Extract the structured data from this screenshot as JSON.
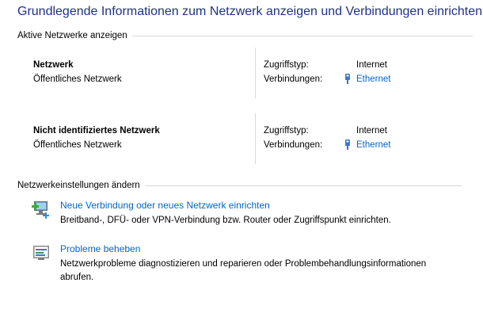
{
  "page_title": "Grundlegende Informationen zum Netzwerk anzeigen und Verbindungen einrichten",
  "active_networks": {
    "heading": "Aktive Netzwerke anzeigen",
    "networks": [
      {
        "name": "Netzwerk",
        "category": "Öffentliches Netzwerk",
        "access_label": "Zugriffstyp:",
        "access_value": "Internet",
        "connections_label": "Verbindungen:",
        "connection_link": "Ethernet"
      },
      {
        "name": "Nicht identifiziertes Netzwerk",
        "category": "Öffentliches Netzwerk",
        "access_label": "Zugriffstyp:",
        "access_value": "Internet",
        "connections_label": "Verbindungen:",
        "connection_link": "Ethernet"
      }
    ]
  },
  "change_settings": {
    "heading": "Netzwerkeinstellungen ändern",
    "tasks": [
      {
        "link": "Neue Verbindung oder neues Netzwerk einrichten",
        "description": "Breitband-, DFÜ- oder VPN-Verbindung bzw. Router oder Zugriffspunkt einrichten.",
        "icon": "new-connection-icon"
      },
      {
        "link": "Probleme beheben",
        "description": "Netzwerkprobleme diagnostizieren und reparieren oder Problembehandlungsinformationen abrufen.",
        "icon": "troubleshoot-icon"
      }
    ]
  },
  "colors": {
    "title": "#1e3287",
    "link": "#0066cc",
    "rule": "#d8d8d8"
  }
}
